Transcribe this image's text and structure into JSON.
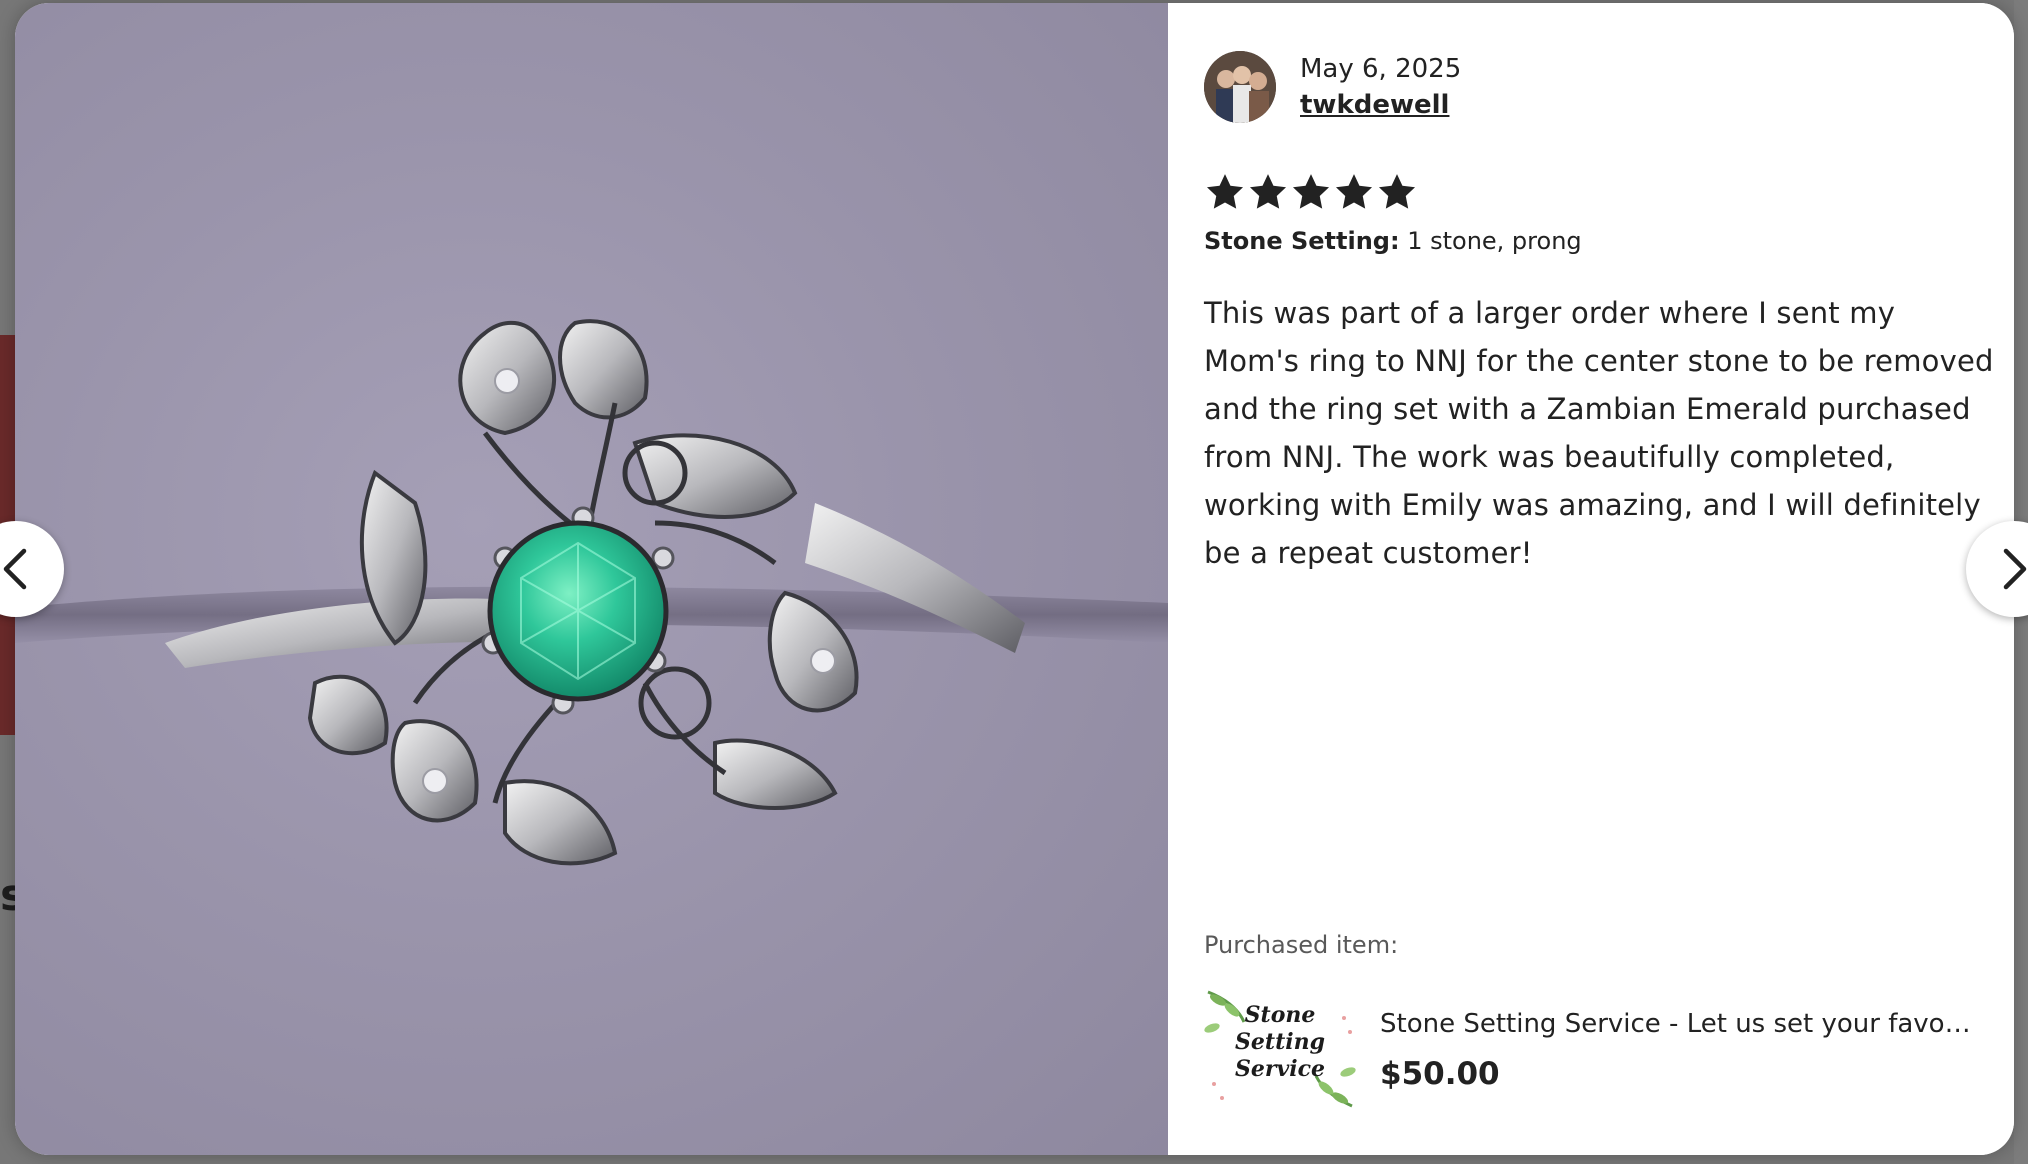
{
  "background": {
    "partial_letter": "s"
  },
  "review": {
    "date": "May 6, 2025",
    "reviewer_name": "twkdewell",
    "rating": 5,
    "rating_max": 5,
    "attribute_label": "Stone Setting:",
    "attribute_value": "1 stone, prong",
    "body": "This was part of a larger order where I sent my Mom's ring to NNJ for the center stone to be removed and the ring set with a Zambian Emerald purchased from NNJ. The work was beautifully completed, working with Emily was amazing, and I will definitely be a repeat customer!"
  },
  "purchased": {
    "label": "Purchased item:",
    "thumb_text_line1": "Stone",
    "thumb_text_line2": "Setting",
    "thumb_text_line3": "Service",
    "title": "Stone Setting Service - Let us set your favorit...",
    "price": "$50.00"
  },
  "icons": {
    "prev": "chevron-left-icon",
    "next": "chevron-right-icon",
    "star": "star-icon"
  },
  "colors": {
    "text": "#222222",
    "muted": "#595959",
    "photo_bg": "#9a94ab",
    "emerald": "#2fc79a"
  }
}
